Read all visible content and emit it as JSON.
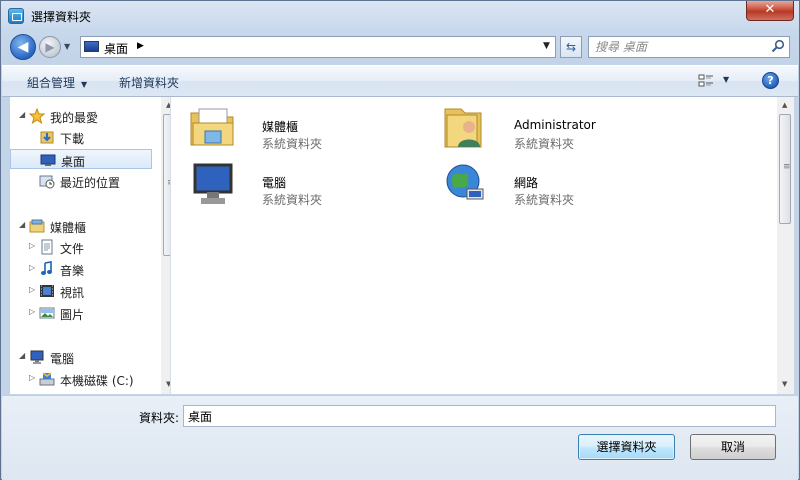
{
  "window": {
    "title": "選擇資料夾",
    "close_glyph": "✕"
  },
  "address_bar": {
    "location": "桌面",
    "search_placeholder": "搜尋 桌面"
  },
  "toolbar": {
    "organize_label": "組合管理",
    "new_folder_label": "新增資料夾"
  },
  "nav_pane": {
    "items": [
      {
        "label": "我的最愛",
        "icon": "star-icon",
        "level": 0,
        "expander": "open"
      },
      {
        "label": "下載",
        "icon": "downloads-icon",
        "level": 1,
        "expander": "none"
      },
      {
        "label": "桌面",
        "icon": "desktop-icon",
        "level": 1,
        "expander": "none",
        "selected": true
      },
      {
        "label": "最近的位置",
        "icon": "recent-places-icon",
        "level": 1,
        "expander": "none"
      },
      {
        "label": "媒體櫃",
        "icon": "libraries-icon",
        "level": 0,
        "expander": "open"
      },
      {
        "label": "文件",
        "icon": "documents-icon",
        "level": 1,
        "expander": "closed"
      },
      {
        "label": "音樂",
        "icon": "music-icon",
        "level": 1,
        "expander": "closed"
      },
      {
        "label": "視訊",
        "icon": "video-icon",
        "level": 1,
        "expander": "closed"
      },
      {
        "label": "圖片",
        "icon": "pictures-icon",
        "level": 1,
        "expander": "closed"
      },
      {
        "label": "電腦",
        "icon": "computer-icon",
        "level": 0,
        "expander": "open"
      },
      {
        "label": "本機磁碟 (C:)",
        "icon": "local-disk-icon",
        "level": 1,
        "expander": "closed"
      }
    ]
  },
  "content": {
    "items": [
      {
        "name": "媒體櫃",
        "type": "系統資料夾",
        "icon": "libraries-folder-icon"
      },
      {
        "name": "Administrator",
        "type": "系統資料夾",
        "icon": "user-folder-icon"
      },
      {
        "name": "電腦",
        "type": "系統資料夾",
        "icon": "computer-icon"
      },
      {
        "name": "網路",
        "type": "系統資料夾",
        "icon": "network-globe-icon"
      }
    ]
  },
  "footer": {
    "folder_label": "資料夾:",
    "folder_value": "桌面",
    "select_button": "選擇資料夾",
    "cancel_button": "取消"
  }
}
